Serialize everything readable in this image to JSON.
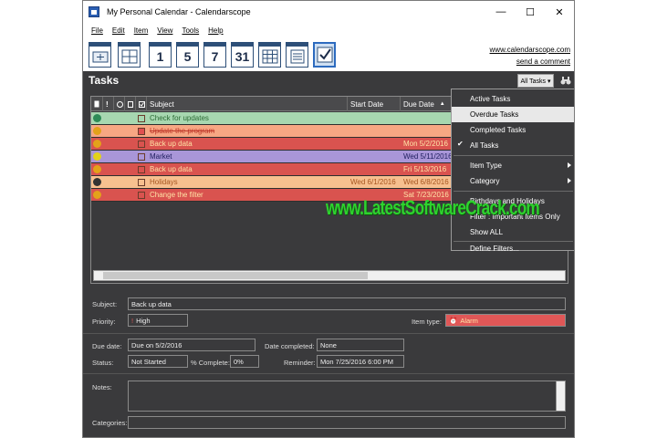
{
  "window": {
    "title": "My Personal Calendar - Calendarscope",
    "controls": [
      "—",
      "☐",
      "✕"
    ]
  },
  "menu": [
    "File",
    "Edit",
    "Item",
    "View",
    "Tools",
    "Help"
  ],
  "toolbar": {
    "buttons": [
      {
        "name": "new-item",
        "num": ""
      },
      {
        "name": "day-view-grid",
        "num": ""
      },
      {
        "name": "day-view",
        "num": "1"
      },
      {
        "name": "five-day-view",
        "num": "5"
      },
      {
        "name": "week-view",
        "num": "7"
      },
      {
        "name": "month-view",
        "num": "31"
      },
      {
        "name": "year-view",
        "num": ""
      },
      {
        "name": "notes-view",
        "num": ""
      },
      {
        "name": "tasks-view",
        "num": ""
      }
    ],
    "link_site": "www.calendarscope.com",
    "link_comment": "send a comment"
  },
  "tasks": {
    "title": "Tasks",
    "filter_button": "All Tasks ▾",
    "columns": [
      "Subject",
      "Start Date",
      "Due Date"
    ],
    "rows": [
      {
        "subject": "Check for updates",
        "start": "",
        "due": "",
        "bg": "#a7d7b0",
        "fg": "#2c6b35",
        "checked": false,
        "strike": false
      },
      {
        "subject": "Update the program",
        "start": "",
        "due": "",
        "bg": "#f7a783",
        "fg": "#c0392b",
        "checked": true,
        "strike": true
      },
      {
        "subject": "Back up data",
        "start": "",
        "due": "Mon 5/2/2016",
        "bg": "#d9534f",
        "fg": "#ffe3a6",
        "checked": false,
        "strike": false
      },
      {
        "subject": "Market",
        "start": "",
        "due": "Wed 5/11/2016",
        "bg": "#a996d8",
        "fg": "#1d1d5e",
        "checked": false,
        "strike": false
      },
      {
        "subject": "Back up data",
        "start": "",
        "due": "Fri 5/13/2016",
        "bg": "#d9534f",
        "fg": "#ffe3a6",
        "checked": false,
        "strike": false
      },
      {
        "subject": "Holidays",
        "start": "Wed 6/1/2016",
        "due": "Wed 6/8/2016",
        "bg": "#f7c08f",
        "fg": "#a65520",
        "checked": false,
        "strike": false
      },
      {
        "subject": "Change the filter",
        "start": "",
        "due": "Sat 7/23/2016",
        "bg": "#d9534f",
        "fg": "#ffe3a6",
        "checked": false,
        "strike": false
      }
    ]
  },
  "dropdown": {
    "items": [
      "Active Tasks",
      "Overdue Tasks",
      "Completed Tasks",
      "All Tasks",
      "Item Type",
      "Category",
      "Birthdays and Holidays",
      "Filter : Important Items Only",
      "Show ALL",
      "Define Filters..."
    ],
    "highlighted": "Overdue Tasks",
    "checked": "All Tasks"
  },
  "watermark": "www.LatestSoftwareCrack.com",
  "details": {
    "subject_label": "Subject:",
    "subject_value": "Back up data",
    "priority_label": "Priority:",
    "priority_value": "High",
    "item_type_label": "Item type:",
    "item_type_value": "Alarm",
    "due_label": "Due date:",
    "due_value": "Due on 5/2/2016",
    "completed_label": "Date completed:",
    "completed_value": "None",
    "status_label": "Status:",
    "status_value": "Not Started",
    "pct_label": "% Complete:",
    "pct_value": "0%",
    "reminder_label": "Reminder:",
    "reminder_value": "Mon 7/25/2016 6:00 PM",
    "notes_label": "Notes:",
    "categories_label": "Categories:"
  },
  "colors": {
    "accent": "#2d6bbf",
    "alarm": "#e05757",
    "bg": "#3a3a3c"
  }
}
